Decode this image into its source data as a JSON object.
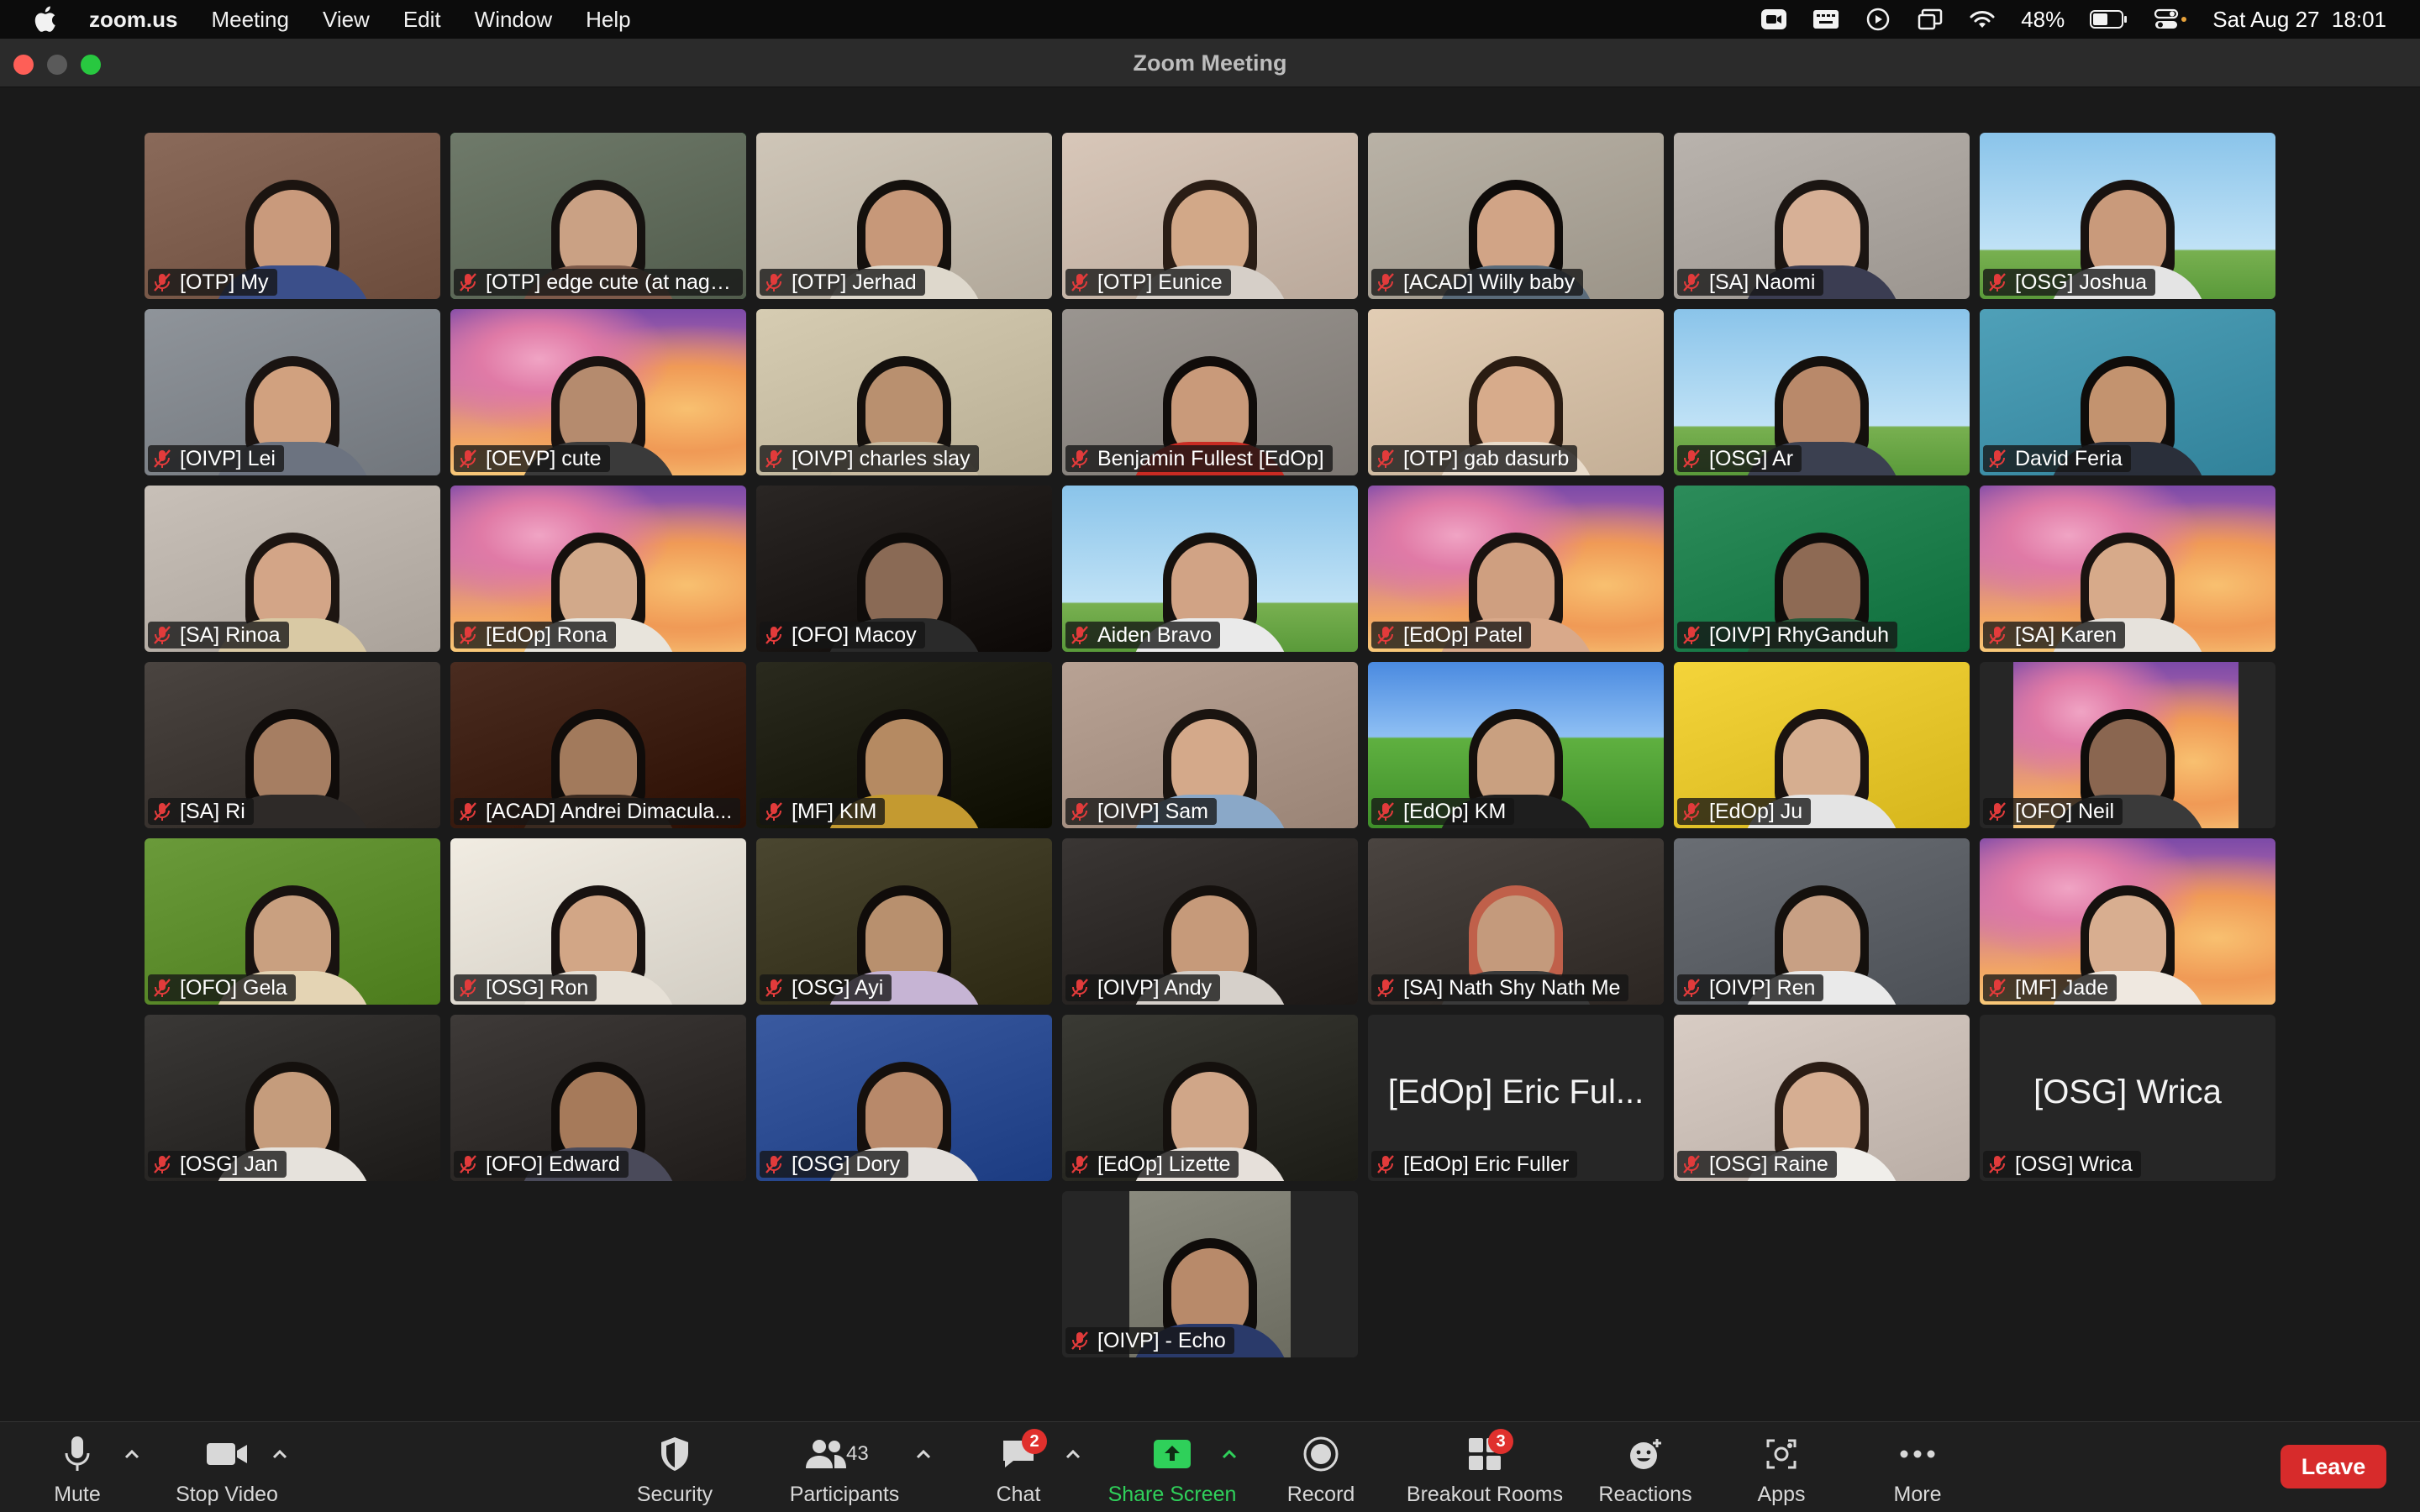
{
  "menubar": {
    "app_name": "zoom.us",
    "menus": [
      "Meeting",
      "View",
      "Edit",
      "Window",
      "Help"
    ],
    "battery": "48%",
    "datetime": "Sat Aug 27  18:01"
  },
  "window": {
    "title": "Zoom Meeting"
  },
  "participants": [
    {
      "name": "[OTP] My",
      "bg": "#8a6a5a",
      "skin": "#c99a7c",
      "hair": "#1b1410",
      "shirt": "#3b4f8a"
    },
    {
      "name": "[OTP] edge cute (at nagha...",
      "bg": "#6f7a6a",
      "skin": "#caa184",
      "hair": "#161210",
      "shirt": "#7d5a4a",
      "active": true
    },
    {
      "name": "[OTP] Jerhad",
      "bg": "#cfc6b8",
      "skin": "#c79879",
      "hair": "#14100d",
      "shirt": "#ded8cc"
    },
    {
      "name": "[OTP] Eunice",
      "bg": "#d8c7b9",
      "skin": "#d2a888",
      "hair": "#2a1d15",
      "shirt": "#d6cfc8"
    },
    {
      "name": "[ACAD] Willy baby",
      "bg": "#b9b2a6",
      "skin": "#d1a486",
      "hair": "#0f0c0a",
      "shirt": "#5a6b7a"
    },
    {
      "name": "[SA] Naomi",
      "bg": "#b9b3ad",
      "skin": "#d7b096",
      "hair": "#1b1512",
      "shirt": "#3b3d52"
    },
    {
      "name": "[OSG] Joshua",
      "bg": "#9fd0ee",
      "skin": "#c99a7b",
      "hair": "#181210",
      "shirt": "#e4e4e4",
      "flowers": true
    },
    {
      "name": "[OIVP] Lei",
      "bg": "#8f949a",
      "skin": "#d1a17f",
      "hair": "#1a1412",
      "shirt": "#6c7380"
    },
    {
      "name": "[OEVP] cute",
      "bg": "sinag",
      "skin": "#b58b6e",
      "hair": "#181210",
      "shirt": "#3a3a3a"
    },
    {
      "name": "[OIVP] charles slay",
      "bg": "#d6ccb2",
      "skin": "#b9906f",
      "hair": "#14100d",
      "shirt": "#c8bba0"
    },
    {
      "name": "Benjamin Fullest [EdOp]",
      "bg": "#9a9590",
      "skin": "#c99a7a",
      "hair": "#100c0a",
      "shirt": "#c92b23"
    },
    {
      "name": "[OTP] gab dasurb",
      "bg": "#e2cdb4",
      "skin": "#d7ab8b",
      "hair": "#2a1c12",
      "shirt": "#e9dccb"
    },
    {
      "name": "[OSG] Ar",
      "bg": "#9fd0ee",
      "skin": "#b9896a",
      "hair": "#14100d",
      "shirt": "#3b4050",
      "flowers": true
    },
    {
      "name": "David Feria",
      "bg": "#4fa0b8",
      "skin": "#c3936f",
      "hair": "#0f0c0a",
      "shirt": "#2a2f3a"
    },
    {
      "name": "[SA] Rinoa",
      "bg": "#c8c0b8",
      "skin": "#d3a587",
      "hair": "#1d1511",
      "shirt": "#d9c9a4"
    },
    {
      "name": "[EdOp] Rona",
      "bg": "sinag",
      "skin": "#d2a98a",
      "hair": "#15100d",
      "shirt": "#e8e4dc"
    },
    {
      "name": "[OFO] Macoy",
      "bg": "#2a2624",
      "skin": "#8a6a55",
      "hair": "#0f0c0a",
      "shirt": "#2a2a2a"
    },
    {
      "name": "Aiden Bravo",
      "bg": "#9fd0ee",
      "skin": "#d1a385",
      "hair": "#15110e",
      "shirt": "#eaeaea",
      "flowers": true
    },
    {
      "name": "[EdOp] Patel",
      "bg": "sinag",
      "skin": "#cf9f80",
      "hair": "#1a1310",
      "shirt": "#d9a98a"
    },
    {
      "name": "[OIVP] RhyGanduh",
      "bg": "#2c8c5a",
      "skin": "#8e6a54",
      "hair": "#0f0c0a",
      "shirt": "#2a5a3a"
    },
    {
      "name": "[SA] Karen",
      "bg": "sinag",
      "skin": "#d7aa8a",
      "hair": "#1a1310",
      "shirt": "#e6e2dc"
    },
    {
      "name": "[SA] Ri",
      "bg": "#4a4440",
      "skin": "#a67e62",
      "hair": "#100c0a",
      "shirt": "#2e2a28"
    },
    {
      "name": "[ACAD] Andrei Dimacula...",
      "bg": "#4a2c20",
      "skin": "#a27a5c",
      "hair": "#100c0a",
      "shirt": "#3a2a20"
    },
    {
      "name": "[MF] KIM",
      "bg": "#2a2a1e",
      "skin": "#b58a62",
      "hair": "#0f0c0a",
      "shirt": "#c49a30"
    },
    {
      "name": "[OIVP] Sam",
      "bg": "#b8a294",
      "skin": "#d4a98a",
      "hair": "#1a1410",
      "shirt": "#8aa8c8"
    },
    {
      "name": "[EdOp] KM",
      "bg": "xp",
      "skin": "#c9a080",
      "hair": "#14100d",
      "shirt": "#1e1e1e"
    },
    {
      "name": "[EdOp] Ju",
      "bg": "#f4d43a",
      "skin": "#d6ae90",
      "hair": "#1a1310",
      "shirt": "#e4e4e4"
    },
    {
      "name": "[OFO] Neil",
      "bg": "sinag-narrow",
      "skin": "#8a6650",
      "hair": "#0f0c0a",
      "shirt": "#3a3a3a"
    },
    {
      "name": "[OFO] Gela",
      "bg": "#6a9a3a",
      "skin": "#c9a080",
      "hair": "#181210",
      "shirt": "#e4d4b4"
    },
    {
      "name": "[OSG] Ron",
      "bg": "#f1ece2",
      "skin": "#d2a686",
      "hair": "#181210",
      "shirt": "#e6e0d6"
    },
    {
      "name": "[OSG] Ayi",
      "bg": "#4a4630",
      "skin": "#b8906e",
      "hair": "#100c0a",
      "shirt": "#c6b4d4"
    },
    {
      "name": "[OIVP] Andy",
      "bg": "#3a3634",
      "skin": "#c69a7a",
      "hair": "#14100d",
      "shirt": "#d6d0ca"
    },
    {
      "name": "[SA] Nath Shy Nath Me",
      "bg": "#4a4440",
      "skin": "#c49a7c",
      "hair": "#c0604a",
      "shirt": "#3a3a3a"
    },
    {
      "name": "[OIVP] Ren",
      "bg": "#6a6e74",
      "skin": "#c8a084",
      "hair": "#14100d",
      "shirt": "#eaeaea"
    },
    {
      "name": "[MF] Jade",
      "bg": "sinag",
      "skin": "#d8ae90",
      "hair": "#15110e",
      "shirt": "#efe8e0"
    },
    {
      "name": "[OSG] Jan",
      "bg": "#3a3836",
      "skin": "#c59c7c",
      "hair": "#14100d",
      "shirt": "#e6e2dc"
    },
    {
      "name": "[OFO] Edward",
      "bg": "#3e3a38",
      "skin": "#a67a5a",
      "hair": "#0f0c0a",
      "shirt": "#4a4a5a"
    },
    {
      "name": "[OSG] Dory",
      "bg": "#3a5aa0",
      "skin": "#b8896a",
      "hair": "#15100d",
      "shirt": "#e4e0dc"
    },
    {
      "name": "[EdOp] Lizette",
      "bg": "#3a3a34",
      "skin": "#d0a688",
      "hair": "#14100d",
      "shirt": "#e6e0da"
    },
    {
      "name": "[EdOp] Eric Fuller",
      "display_name": "[EdOp] Eric Ful...",
      "video_off": true
    },
    {
      "name": "[OSG] Raine",
      "bg": "#d8ccc4",
      "skin": "#d6ae92",
      "hair": "#2a1c14",
      "shirt": "#f0eeea"
    },
    {
      "name": "[OSG] Wrica",
      "display_name": "[OSG] Wrica",
      "video_off": true
    },
    {
      "name": "[OIVP] - Echo",
      "bg": "#8a8a7e",
      "skin": "#b88a6a",
      "hair": "#0f0c0a",
      "shirt": "#2a3a6a",
      "narrow": true
    }
  ],
  "toolbar": {
    "mute": "Mute",
    "stop_video": "Stop Video",
    "security": "Security",
    "participants": "Participants",
    "participants_count": "43",
    "chat": "Chat",
    "chat_badge": "2",
    "share_screen": "Share Screen",
    "record": "Record",
    "breakout_rooms": "Breakout Rooms",
    "breakout_badge": "3",
    "reactions": "Reactions",
    "apps": "Apps",
    "more": "More",
    "leave": "Leave"
  }
}
